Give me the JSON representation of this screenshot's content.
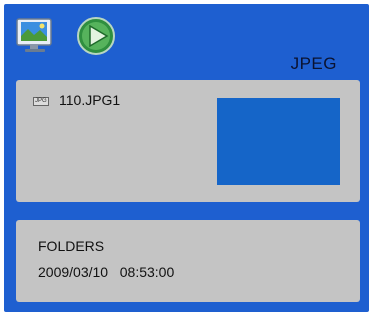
{
  "header": {
    "mode": "JPEG",
    "icons": [
      "monitor-icon",
      "play-icon"
    ]
  },
  "file_panel": {
    "file_type_tag": "JPG",
    "filename": "110.JPG1"
  },
  "info_panel": {
    "folders_label": "FOLDERS",
    "date": "2009/03/10",
    "time": "08:53:00"
  },
  "colors": {
    "background": "#1e5fd0",
    "panel": "#c4c4c4",
    "preview": "#1565c8"
  }
}
